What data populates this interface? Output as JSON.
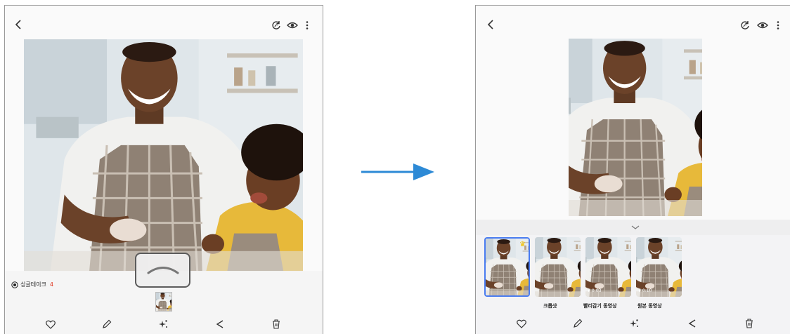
{
  "left_screen": {
    "icons": {
      "back": "back-chevron-icon",
      "remaster": "remaster-icon",
      "view": "eye-icon",
      "more": "more-vertical-icon"
    },
    "single_take": {
      "label": "싱글테이크",
      "count": "4"
    },
    "swipe_hint_icon": "chevron-up-icon",
    "bottom_actions": [
      "heart-icon",
      "edit-pencil-icon",
      "sparkle-effects-icon",
      "share-icon",
      "trash-icon"
    ]
  },
  "transition_arrow_icon": "right-arrow-icon",
  "right_screen": {
    "icons": {
      "back": "back-chevron-icon",
      "remaster": "remaster-icon",
      "view": "eye-icon",
      "more": "more-vertical-icon",
      "collapse": "chevron-down-icon"
    },
    "results": [
      {
        "label": "",
        "duration": "",
        "selected": true,
        "badge": "crown-icon"
      },
      {
        "label": "크롭샷",
        "duration": "",
        "selected": false
      },
      {
        "label": "빨리감기 동영상",
        "duration": "▸ 0:03",
        "selected": false
      },
      {
        "label": "원본 동영상",
        "duration": "▸ 0:10",
        "selected": false
      }
    ],
    "bottom_actions": [
      "heart-icon",
      "edit-pencil-icon",
      "sparkle-effects-icon",
      "share-icon",
      "trash-icon"
    ]
  },
  "colors": {
    "accent_blue": "#2d8ad6",
    "selection_blue": "#4a7cf0",
    "count_red": "#e0321c",
    "crown_gold": "#f2c100"
  }
}
